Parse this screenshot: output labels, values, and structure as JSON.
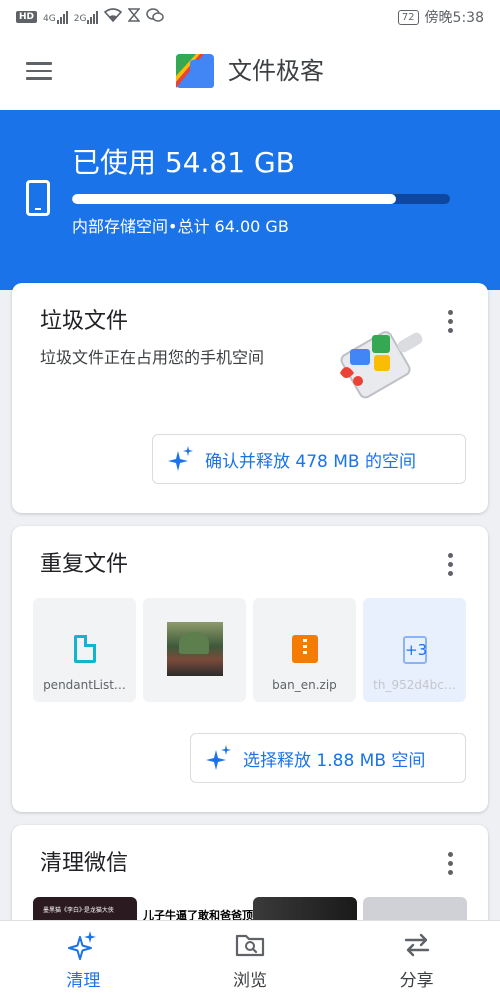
{
  "status_bar": {
    "hd": "HD",
    "sim1": "4G",
    "sim2": "2G",
    "battery": "72",
    "time": "傍晚5:38"
  },
  "app_bar": {
    "title": "文件极客",
    "menu_icon": "menu-icon"
  },
  "storage": {
    "used_label": "已使用 54.81 GB",
    "subtitle": "内部存储空间•总计 64.00 GB",
    "used_fraction": 0.856,
    "icon": "phone-icon"
  },
  "junk_card": {
    "title": "垃圾文件",
    "description": "垃圾文件正在占用您的手机空间",
    "button_label": "确认并释放 478 MB 的空间"
  },
  "duplicate_card": {
    "title": "重复文件",
    "files": [
      {
        "name": "pendantList…",
        "icon": "document-icon"
      },
      {
        "name": "",
        "icon": "image-thumbnail"
      },
      {
        "name": "ban_en.zip",
        "icon": "zip-icon"
      },
      {
        "name": "th_952d4bc…",
        "badge": "+3"
      }
    ],
    "button_label": "选择释放 1.88 MB 空间"
  },
  "wechat_card": {
    "title": "清理微信",
    "thumb1_text": "墨黑猫《李白》·是龙猫大侠",
    "thumb2_text": "儿子牛逼了敢和爸爸顶嘴了"
  },
  "bottom_nav": {
    "items": [
      {
        "label": "清理",
        "icon": "sparkle-icon",
        "active": true
      },
      {
        "label": "浏览",
        "icon": "folder-search-icon",
        "active": false
      },
      {
        "label": "分享",
        "icon": "swap-arrows-icon",
        "active": false
      }
    ]
  },
  "colors": {
    "accent": "#1a73e8",
    "header_bg": "#1a73e8",
    "bar_track": "#0d47a1"
  }
}
